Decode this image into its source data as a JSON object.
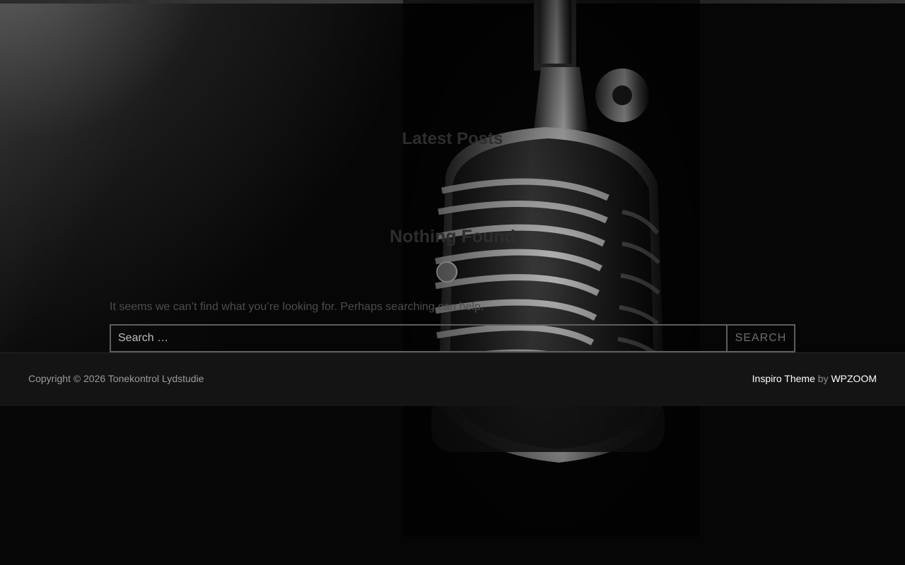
{
  "content": {
    "latest_posts_title": "Latest Posts",
    "nothing_found_title": "Nothing Found",
    "message": "It seems we can’t find what you’re looking for. Perhaps searching can help."
  },
  "search": {
    "placeholder": "Search …",
    "value": "",
    "button_label": "Search"
  },
  "footer": {
    "copyright": "Copyright © 2026 Tonekontrol Lydstudie",
    "theme_link": "Inspiro Theme",
    "by_text": "by",
    "author_link": "WPZOOM"
  },
  "images": {
    "hero_background": "vintage-microphone-photo"
  },
  "colors": {
    "background": "#050505",
    "footer_background": "#141414",
    "heading_text": "#2d2d2d",
    "link_text": "#ffffff"
  }
}
